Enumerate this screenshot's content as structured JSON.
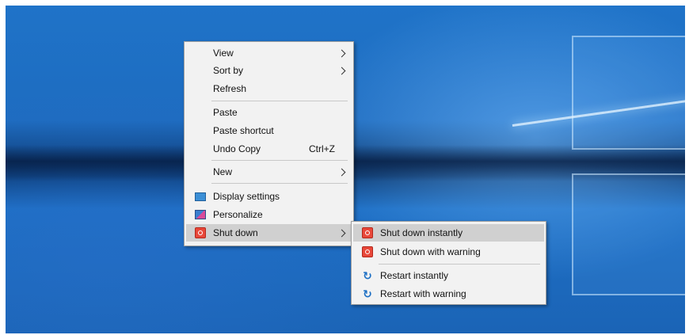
{
  "context_menu": {
    "items": [
      {
        "label": "View",
        "submenu": true
      },
      {
        "label": "Sort by",
        "submenu": true
      },
      {
        "label": "Refresh"
      },
      {
        "label": "Paste"
      },
      {
        "label": "Paste shortcut"
      },
      {
        "label": "Undo Copy",
        "shortcut": "Ctrl+Z"
      },
      {
        "label": "New",
        "submenu": true
      },
      {
        "label": "Display settings",
        "icon": "display-icon"
      },
      {
        "label": "Personalize",
        "icon": "personalize-icon"
      },
      {
        "label": "Shut down",
        "icon": "power-icon",
        "submenu": true,
        "highlighted": true
      }
    ]
  },
  "submenu": {
    "items": [
      {
        "label": "Shut down instantly",
        "icon": "power-icon",
        "highlighted": true
      },
      {
        "label": "Shut down with warning",
        "icon": "power-icon"
      },
      {
        "label": "Restart instantly",
        "icon": "restart-icon"
      },
      {
        "label": "Restart with warning",
        "icon": "restart-icon"
      }
    ]
  },
  "colors": {
    "menu_background": "#f2f2f2",
    "highlight": "#d0d0d0",
    "desktop_blue": "#1e6cc0"
  }
}
